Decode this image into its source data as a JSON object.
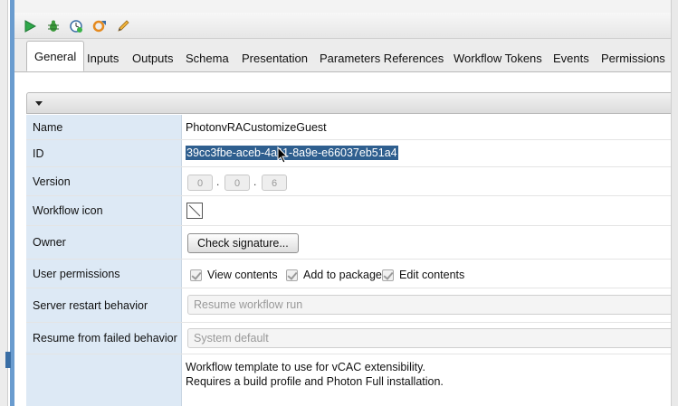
{
  "toolbar": {
    "buttons": [
      {
        "icon": "run-icon"
      },
      {
        "icon": "debug-icon"
      },
      {
        "icon": "schedule-icon"
      },
      {
        "icon": "validate-icon"
      },
      {
        "icon": "edit-icon"
      }
    ]
  },
  "tabs": [
    {
      "label": "General",
      "active": true
    },
    {
      "label": "Inputs"
    },
    {
      "label": "Outputs"
    },
    {
      "label": "Schema"
    },
    {
      "label": "Presentation"
    },
    {
      "label": "Parameters References"
    },
    {
      "label": "Workflow Tokens"
    },
    {
      "label": "Events"
    },
    {
      "label": "Permissions"
    }
  ],
  "form": {
    "name_label": "Name",
    "name_value": "PhotonvRACustomizeGuest",
    "id_label": "ID",
    "id_value": "39cc3fbe-aceb-4a11-8a9e-e66037eb51a4",
    "version_label": "Version",
    "version_major": "0",
    "version_minor": "0",
    "version_patch": "6",
    "version_sep": ".",
    "icon_label": "Workflow icon",
    "owner_label": "Owner",
    "owner_button": "Check signature...",
    "permissions_label": "User permissions",
    "perm_view": "View contents",
    "perm_add": "Add to package",
    "perm_edit": "Edit contents",
    "restart_label": "Server restart behavior",
    "restart_value": "Resume workflow run",
    "resume_label": "Resume from failed behavior",
    "resume_value": "System default",
    "description_line1": "Workflow template to use for vCAC extensibility.",
    "description_line2": "Requires a build profile and Photon Full installation."
  },
  "colors": {
    "label_bg": "#dde9f5",
    "selection_bg": "#2f5f8f",
    "accent_blue": "#6a9ccf"
  }
}
